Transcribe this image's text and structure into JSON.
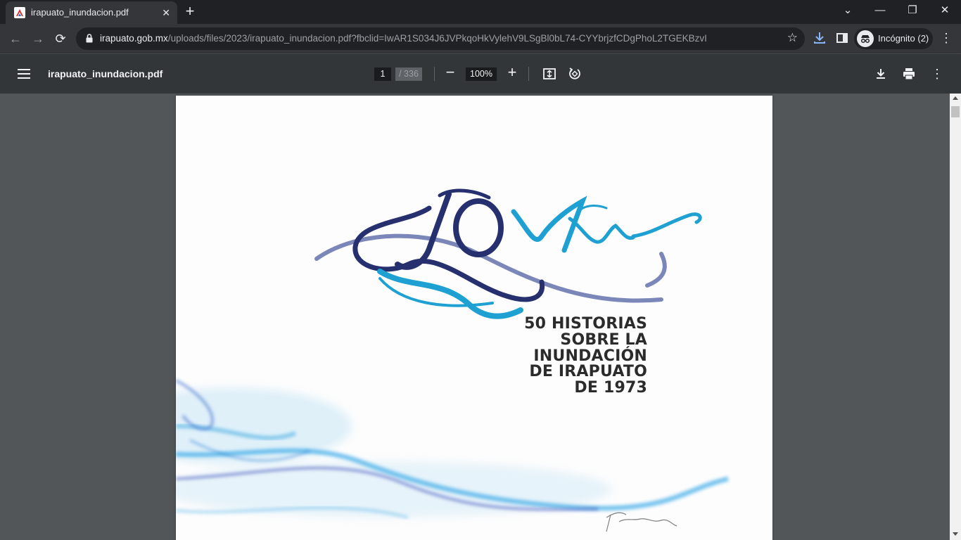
{
  "browser": {
    "tab": {
      "title": "irapuato_inundacion.pdf",
      "favicon": "pdf-icon"
    },
    "url": {
      "host": "irapuato.gob.mx",
      "path": "/uploads/files/2023/irapuato_inundacion.pdf?fbclid=IwAR1S034J6JVPkqoHkVylehV9LSgBl0bL74-CYYbrjzfCDgPhoL2TGEKBzvI"
    },
    "profile_label": "Incógnito (2)"
  },
  "pdf_toolbar": {
    "filename": "irapuato_inundacion.pdf",
    "current_page": "1",
    "total_pages": "/ 336",
    "zoom": "100%"
  },
  "cover": {
    "logo_text": "50 Años",
    "title_lines": [
      "50 HISTORIAS",
      "SOBRE LA",
      "INUNDACIÓN",
      "DE IRAPUATO",
      "DE 1973"
    ],
    "signature": "Takaba '23",
    "colors": {
      "navy": "#26306e",
      "cyan": "#1ea1d2",
      "slate": "#7a87b8"
    }
  }
}
